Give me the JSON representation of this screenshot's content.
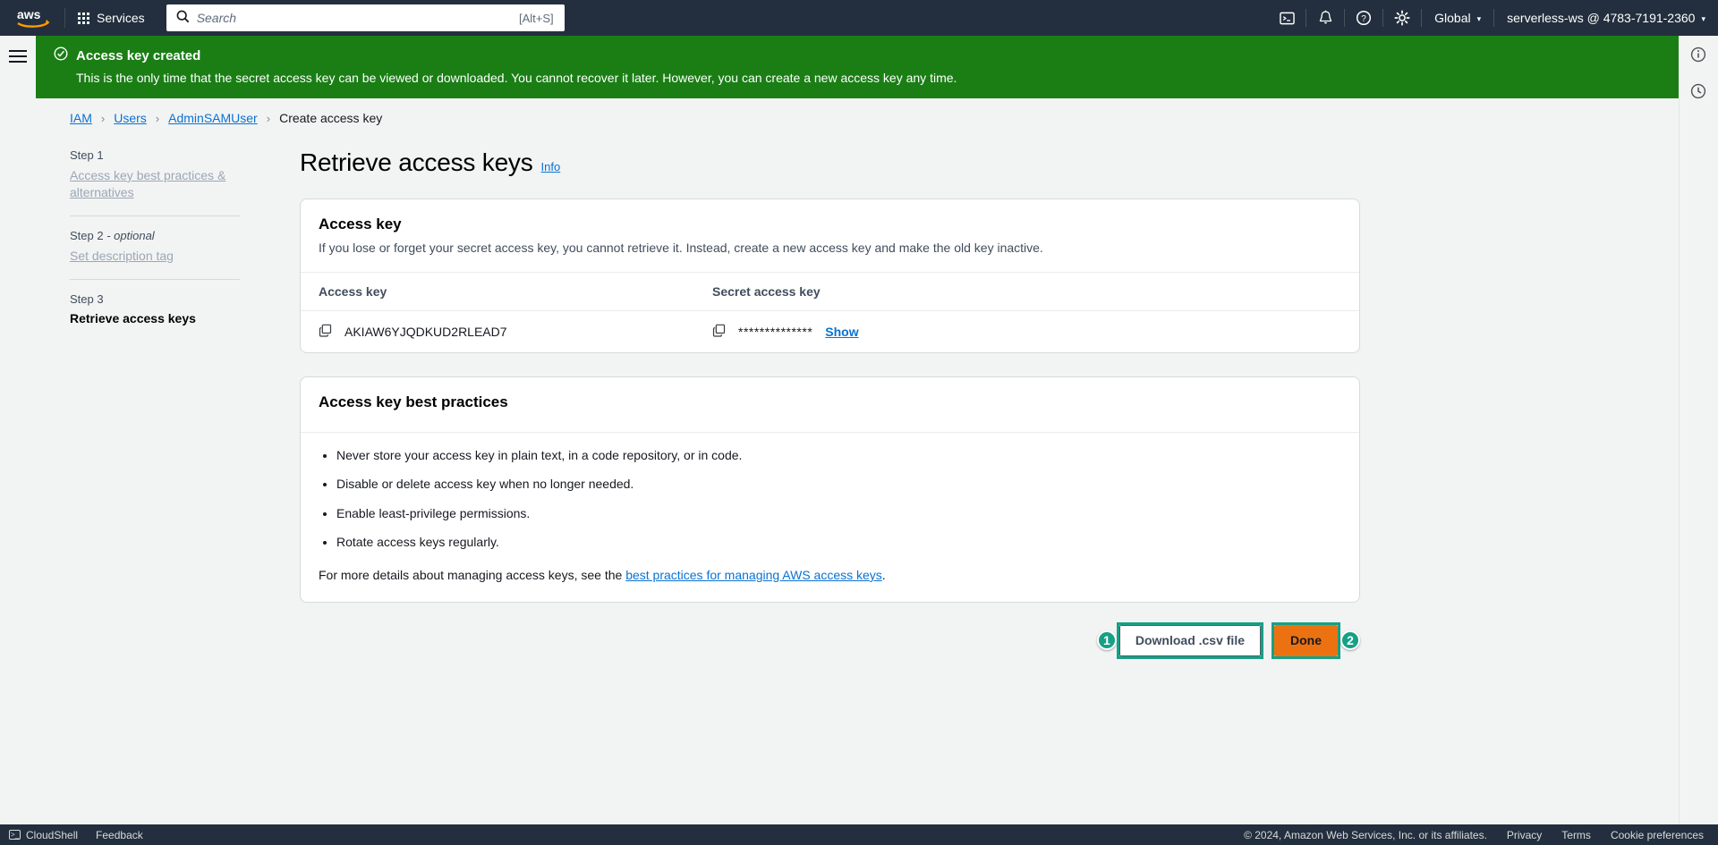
{
  "topnav": {
    "logo_alt": "aws",
    "services_label": "Services",
    "search_placeholder": "Search",
    "search_value": "",
    "search_shortcut": "[Alt+S]",
    "cloudshell_icon": "cloudshell-icon",
    "notifications_icon": "bell-icon",
    "help_icon": "help-icon",
    "settings_icon": "gear-icon",
    "region_label": "Global",
    "account_label": "serverless-ws @ 4783-7191-2360",
    "caret": "▾"
  },
  "banner": {
    "icon": "success-check-icon",
    "title": "Access key created",
    "description": "This is the only time that the secret access key can be viewed or downloaded. You cannot recover it later. However, you can create a new access key any time.",
    "color": "#1a7e15"
  },
  "right_rail": {
    "info_icon": "info-circle-icon",
    "history_icon": "clock-history-icon"
  },
  "breadcrumb": {
    "items": [
      {
        "label": "IAM",
        "link": true
      },
      {
        "label": "Users",
        "link": true
      },
      {
        "label": "AdminSAMUser",
        "link": true
      },
      {
        "label": "Create access key",
        "link": false
      }
    ],
    "separator": "›"
  },
  "steps": [
    {
      "step": "Step 1",
      "optional": "",
      "title": "Access key best practices & alternatives",
      "current": false
    },
    {
      "step": "Step 2",
      "optional": " - optional",
      "title": "Set description tag",
      "current": false
    },
    {
      "step": "Step 3",
      "optional": "",
      "title": "Retrieve access keys",
      "current": true
    }
  ],
  "page": {
    "title": "Retrieve access keys",
    "info_label": "Info"
  },
  "access_key_card": {
    "title": "Access key",
    "subtitle": "If you lose or forget your secret access key, you cannot retrieve it. Instead, create a new access key and make the old key inactive.",
    "columns": [
      "Access key",
      "Secret access key"
    ],
    "row": {
      "access_key": "AKIAW6YJQDKUD2RLEAD7",
      "secret_masked": "**************",
      "show_label": "Show",
      "copy_icon": "copy-icon"
    }
  },
  "best_practices_card": {
    "title": "Access key best practices",
    "items": [
      "Never store your access key in plain text, in a code repository, or in code.",
      "Disable or delete access key when no longer needed.",
      "Enable least-privilege permissions.",
      "Rotate access keys regularly."
    ],
    "footer_prefix": "For more details about managing access keys, see the ",
    "footer_link": "best practices for managing AWS access keys",
    "footer_suffix": "."
  },
  "actions": {
    "badge_one": "1",
    "download_label": "Download .csv file",
    "badge_two": "2",
    "done_label": "Done",
    "highlight_color": "#16a085",
    "primary_color": "#ec7211"
  },
  "footer": {
    "cloudshell_label": "CloudShell",
    "feedback_label": "Feedback",
    "copyright": "© 2024, Amazon Web Services, Inc. or its affiliates.",
    "privacy_label": "Privacy",
    "terms_label": "Terms",
    "cookie_label": "Cookie preferences"
  }
}
